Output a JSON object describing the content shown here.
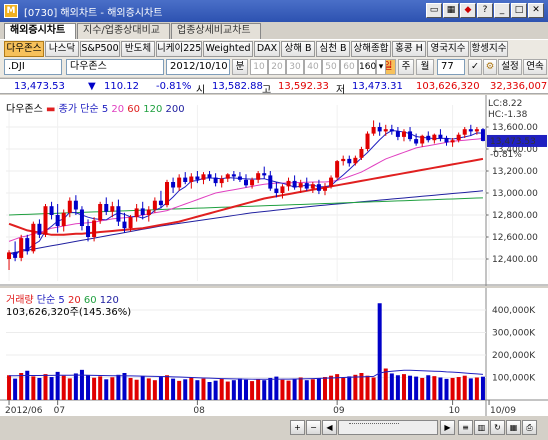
{
  "window": {
    "app_icon": "M",
    "title": "[0730] 해외차트 - 해외증시차트"
  },
  "tabs": [
    {
      "label": "해외증시차트",
      "active": true
    },
    {
      "label": "지수/업종상대비교",
      "active": false
    },
    {
      "label": "업종상세비교차트",
      "active": false
    }
  ],
  "indices": [
    "다우존스",
    "나스닥",
    "S&P500",
    "반도체",
    "니케이225",
    "Weighted",
    "DAX",
    "상해 B",
    "심천 B",
    "상해종합",
    "홍콩 H",
    "영국지수",
    "항셍지수"
  ],
  "selected_index": "다우존스",
  "symbol_bar": {
    "code": ".DJI",
    "name": "다우존스",
    "date": "2012/10/10",
    "period_label": "분",
    "period_options": [
      "10",
      "20",
      "30",
      "40",
      "50",
      "60",
      "160"
    ],
    "day_label": "일",
    "week_label": "주",
    "month_label": "월",
    "count": "77",
    "settings_label": "설정",
    "continuous_label": "연속"
  },
  "quote": {
    "last": "13,473.53",
    "change": "110.12",
    "pct": "-0.81%",
    "open_label": "시",
    "open": "13,582.88",
    "high_label": "고",
    "high": "13,592.33",
    "low_label": "저",
    "low": "13,473.31",
    "volume": "103,626,320",
    "amount": "32,336,007"
  },
  "price_legend": {
    "name": "다우존스",
    "ma_label": "종가 단순",
    "ma": [
      "5",
      "20",
      "60",
      "120",
      "200"
    ]
  },
  "price_badges": {
    "lc": "LC:8.22",
    "hc": "HC:-1.38",
    "current": "13,473.53",
    "pct": "-0.81%"
  },
  "volume_legend": {
    "name": "거래량",
    "ma_label": "단순",
    "ma": [
      "5",
      "20",
      "60",
      "120"
    ],
    "value": "103,626,320주(145.36%)"
  },
  "colors": {
    "up": "#e00000",
    "down": "#0000c8",
    "ma5": "#2020c0",
    "ma20": "#e040c0",
    "ma60": "#e02020",
    "ma120": "#20a040",
    "ma200": "#2020a0"
  },
  "chart_data": [
    {
      "type": "candlestick",
      "title": "다우존스",
      "ylim": [
        12200,
        13800
      ],
      "y_ticks": [
        "13,600.00",
        "13,400.00",
        "13,200.00",
        "13,000.00",
        "12,800.00",
        "12,600.00",
        "12,400.00"
      ],
      "y_tick_values": [
        13600,
        13400,
        13200,
        13000,
        12800,
        12600,
        12400
      ],
      "x_tick_labels": [
        "2012/06",
        "07",
        "08",
        "09",
        "10",
        "10/09"
      ],
      "x_tick_index": [
        0,
        8,
        31,
        54,
        73,
        79
      ],
      "ohlc": [
        [
          12400,
          12480,
          12300,
          12460
        ],
        [
          12460,
          12560,
          12380,
          12410
        ],
        [
          12410,
          12620,
          12380,
          12590
        ],
        [
          12590,
          12620,
          12440,
          12470
        ],
        [
          12470,
          12740,
          12450,
          12720
        ],
        [
          12720,
          12760,
          12590,
          12620
        ],
        [
          12620,
          12900,
          12600,
          12880
        ],
        [
          12880,
          12920,
          12760,
          12800
        ],
        [
          12800,
          12900,
          12640,
          12700
        ],
        [
          12700,
          12850,
          12650,
          12820
        ],
        [
          12820,
          12960,
          12780,
          12930
        ],
        [
          12930,
          12980,
          12800,
          12850
        ],
        [
          12850,
          12880,
          12660,
          12700
        ],
        [
          12700,
          12760,
          12560,
          12600
        ],
        [
          12600,
          12780,
          12560,
          12750
        ],
        [
          12750,
          12920,
          12720,
          12900
        ],
        [
          12900,
          12960,
          12800,
          12830
        ],
        [
          12830,
          12920,
          12780,
          12880
        ],
        [
          12880,
          12940,
          12700,
          12740
        ],
        [
          12740,
          12820,
          12640,
          12680
        ],
        [
          12680,
          12800,
          12650,
          12780
        ],
        [
          12780,
          12900,
          12740,
          12860
        ],
        [
          12860,
          12920,
          12760,
          12800
        ],
        [
          12800,
          12880,
          12740,
          12850
        ],
        [
          12850,
          12960,
          12820,
          12930
        ],
        [
          12930,
          13020,
          12860,
          12890
        ],
        [
          12890,
          13120,
          12870,
          13100
        ],
        [
          13100,
          13140,
          13000,
          13050
        ],
        [
          13050,
          13170,
          13020,
          13140
        ],
        [
          13140,
          13190,
          13080,
          13100
        ],
        [
          13100,
          13180,
          13040,
          13150
        ],
        [
          13150,
          13200,
          13090,
          13120
        ],
        [
          13120,
          13190,
          13080,
          13170
        ],
        [
          13170,
          13200,
          13110,
          13140
        ],
        [
          13140,
          13180,
          13060,
          13090
        ],
        [
          13090,
          13160,
          13050,
          13130
        ],
        [
          13130,
          13180,
          13100,
          13170
        ],
        [
          13170,
          13200,
          13110,
          13150
        ],
        [
          13150,
          13190,
          13100,
          13120
        ],
        [
          13120,
          13170,
          13050,
          13070
        ],
        [
          13070,
          13140,
          13040,
          13120
        ],
        [
          13120,
          13200,
          13090,
          13180
        ],
        [
          13180,
          13240,
          13130,
          13160
        ],
        [
          13160,
          13200,
          13020,
          13040
        ],
        [
          13040,
          13100,
          12960,
          13000
        ],
        [
          13000,
          13080,
          12950,
          13060
        ],
        [
          13060,
          13140,
          13020,
          13110
        ],
        [
          13110,
          13160,
          13030,
          13050
        ],
        [
          13050,
          13120,
          13000,
          13090
        ],
        [
          13090,
          13140,
          13020,
          13040
        ],
        [
          13040,
          13100,
          13000,
          13080
        ],
        [
          13080,
          13120,
          12990,
          13020
        ],
        [
          13020,
          13090,
          12980,
          13060
        ],
        [
          13060,
          13160,
          13040,
          13140
        ],
        [
          13140,
          13300,
          13120,
          13290
        ],
        [
          13290,
          13340,
          13250,
          13310
        ],
        [
          13310,
          13340,
          13240,
          13270
        ],
        [
          13270,
          13340,
          13250,
          13320
        ],
        [
          13320,
          13420,
          13300,
          13400
        ],
        [
          13400,
          13560,
          13380,
          13540
        ],
        [
          13540,
          13660,
          13520,
          13600
        ],
        [
          13600,
          13640,
          13520,
          13560
        ],
        [
          13560,
          13620,
          13520,
          13580
        ],
        [
          13580,
          13620,
          13530,
          13560
        ],
        [
          13560,
          13600,
          13480,
          13510
        ],
        [
          13510,
          13580,
          13470,
          13560
        ],
        [
          13560,
          13600,
          13470,
          13490
        ],
        [
          13490,
          13540,
          13430,
          13450
        ],
        [
          13450,
          13530,
          13420,
          13520
        ],
        [
          13520,
          13560,
          13460,
          13480
        ],
        [
          13480,
          13540,
          13450,
          13530
        ],
        [
          13530,
          13580,
          13470,
          13500
        ],
        [
          13500,
          13520,
          13430,
          13460
        ],
        [
          13460,
          13500,
          13420,
          13480
        ],
        [
          13480,
          13550,
          13460,
          13530
        ],
        [
          13530,
          13600,
          13500,
          13580
        ],
        [
          13580,
          13620,
          13520,
          13560
        ],
        [
          13560,
          13600,
          13530,
          13580
        ],
        [
          13580,
          13590,
          13470,
          13473
        ]
      ],
      "ma20": [
        12560,
        12580,
        12600,
        12610,
        12630,
        12640,
        12660,
        12680,
        12690,
        12700,
        12710,
        12720,
        12725,
        12730,
        12735,
        12745,
        12755,
        12765,
        12770,
        12775,
        12780,
        12790,
        12800,
        12810,
        12820,
        12830,
        12840,
        12860,
        12880,
        12900,
        12920,
        12940,
        12960,
        12980,
        13000,
        13010,
        13020,
        13030,
        13040,
        13050,
        13060,
        13070,
        13080,
        13085,
        13090,
        13090,
        13092,
        13094,
        13096,
        13098,
        13100,
        13100,
        13100,
        13105,
        13115,
        13130,
        13150,
        13170,
        13190,
        13220,
        13250,
        13280,
        13310,
        13330,
        13350,
        13370,
        13390,
        13410,
        13420,
        13430,
        13440,
        13450,
        13460,
        13470,
        13475,
        13480,
        13485,
        13490,
        13495
      ],
      "ma60": [
        12720,
        12700,
        12680,
        12660,
        12650,
        12640,
        12630,
        12620,
        12620,
        12620,
        12625,
        12630,
        12630,
        12635,
        12640,
        12645,
        12650,
        12655,
        12660,
        12665,
        12670,
        12675,
        12680,
        12690,
        12700,
        12710,
        12720,
        12730,
        12740,
        12755,
        12770,
        12785,
        12800,
        12815,
        12830,
        12845,
        12860,
        12875,
        12890,
        12905,
        12920,
        12935,
        12950,
        12960,
        12970,
        12980,
        12990,
        13000,
        13010,
        13020,
        13030,
        13040,
        13050,
        13060,
        13070,
        13080,
        13090,
        13100,
        13110,
        13120,
        13130,
        13140,
        13150,
        13160,
        13170,
        13180,
        13190,
        13200,
        13210,
        13220,
        13230,
        13240,
        13250,
        13260,
        13270,
        13280,
        13290,
        13300,
        13310
      ],
      "ma120": [
        12800,
        12802,
        12804,
        12806,
        12808,
        12810,
        12812,
        12814,
        12816,
        12818,
        12820,
        12822,
        12824,
        12826,
        12828,
        12830,
        12832,
        12834,
        12836,
        12838,
        12840,
        12842,
        12844,
        12846,
        12848,
        12850,
        12852,
        12854,
        12856,
        12858,
        12860,
        12862,
        12864,
        12866,
        12868,
        12870,
        12872,
        12874,
        12876,
        12878,
        12880,
        12882,
        12884,
        12886,
        12888,
        12890,
        12892,
        12894,
        12896,
        12898,
        12900,
        12902,
        12904,
        12906,
        12908,
        12910,
        12912,
        12914,
        12916,
        12918,
        12920,
        12922,
        12924,
        12926,
        12928,
        12930,
        12932,
        12934,
        12936,
        12938,
        12940,
        12942,
        12944,
        12946,
        12948,
        12950,
        12952,
        12954,
        12956
      ],
      "ma200": [
        12450,
        12460,
        12470,
        12480,
        12490,
        12500,
        12510,
        12520,
        12530,
        12540,
        12550,
        12560,
        12570,
        12580,
        12590,
        12600,
        12610,
        12620,
        12630,
        12640,
        12650,
        12660,
        12670,
        12680,
        12690,
        12700,
        12708,
        12716,
        12724,
        12732,
        12740,
        12748,
        12756,
        12764,
        12772,
        12780,
        12788,
        12796,
        12804,
        12812,
        12820,
        12826,
        12832,
        12838,
        12844,
        12850,
        12856,
        12862,
        12868,
        12874,
        12880,
        12885,
        12890,
        12895,
        12900,
        12905,
        12910,
        12915,
        12920,
        12925,
        12930,
        12935,
        12940,
        12945,
        12950,
        12955,
        12960,
        12965,
        12970,
        12975,
        12980,
        12985,
        12990,
        12995,
        13000,
        13005,
        13010,
        13015,
        13020
      ]
    },
    {
      "type": "bar",
      "title": "거래량",
      "ylim": [
        0,
        480000
      ],
      "y_ticks": [
        "400,000K",
        "300,000K",
        "200,000K",
        "100,000K"
      ],
      "y_tick_values": [
        400000,
        300000,
        200000,
        100000
      ],
      "volume_k": [
        110000,
        95000,
        120000,
        130000,
        105000,
        98000,
        115000,
        102000,
        125000,
        108000,
        96000,
        118000,
        134000,
        110000,
        99000,
        105000,
        92000,
        101000,
        112000,
        120000,
        98000,
        90000,
        105000,
        96000,
        88000,
        102000,
        110000,
        95000,
        85000,
        92000,
        100000,
        88000,
        95000,
        80000,
        86000,
        94000,
        82000,
        88000,
        96000,
        90000,
        84000,
        92000,
        88000,
        98000,
        104000,
        90000,
        86000,
        94000,
        100000,
        88000,
        92000,
        96000,
        102000,
        108000,
        115000,
        98000,
        105000,
        112000,
        120000,
        108000,
        100000,
        430000,
        140000,
        118000,
        110000,
        115000,
        108000,
        104000,
        98000,
        110000,
        106000,
        100000,
        94000,
        98000,
        102000,
        108000,
        96000,
        100000,
        103626
      ],
      "ma20_k": [
        108000,
        108000,
        108500,
        109000,
        109000,
        109000,
        109500,
        109500,
        110000,
        110000,
        110000,
        110500,
        110500,
        110000,
        109500,
        109000,
        108500,
        108000,
        108000,
        107500,
        107000,
        106500,
        106000,
        105500,
        105000,
        104500,
        104000,
        103000,
        102000,
        101000,
        100000,
        99000,
        98000,
        97000,
        96000,
        95000,
        94500,
        94000,
        93500,
        93000,
        92500,
        92000,
        92000,
        92000,
        92500,
        93000,
        93000,
        93500,
        94000,
        94500,
        95000,
        96000,
        97000,
        98000,
        99000,
        100000,
        101000,
        102000,
        103000,
        104000,
        105000,
        120000,
        125000,
        128000,
        130000,
        132000,
        132000,
        131000,
        130000,
        129000,
        128000,
        127000,
        125000,
        124000,
        122000,
        120000,
        118000,
        116000,
        114000
      ]
    }
  ]
}
